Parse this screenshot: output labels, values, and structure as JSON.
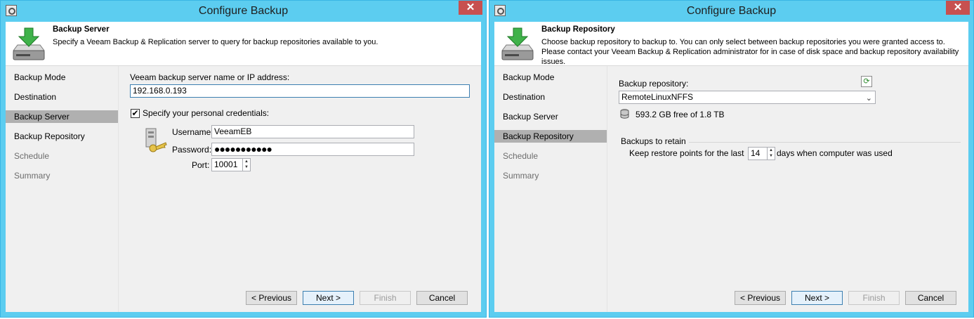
{
  "colors": {
    "titlebar": "#5ccdf0",
    "close": "#c75050",
    "accent": "#3c7fb1",
    "selected": "#b0b0b0"
  },
  "left": {
    "title": "Configure Backup",
    "close_label": "✕",
    "header": {
      "title": "Backup Server",
      "description": "Specify a Veeam Backup & Replication server to query for backup repositories available to you.",
      "icon": "download-drive-icon"
    },
    "nav": [
      {
        "label": "Backup Mode",
        "state": "normal"
      },
      {
        "label": "Destination",
        "state": "normal"
      },
      {
        "label": "Backup Server",
        "state": "active"
      },
      {
        "label": "Backup Repository",
        "state": "normal"
      },
      {
        "label": "Schedule",
        "state": "disabled"
      },
      {
        "label": "Summary",
        "state": "disabled"
      }
    ],
    "form": {
      "server_label": "Veeam backup server name or IP address:",
      "server_value": "192.168.0.193",
      "credentials_label": "Specify your personal credentials:",
      "credentials_checked": true,
      "username_label": "Username:",
      "username_value": "VeeamEB",
      "password_label": "Password:",
      "password_value": "●●●●●●●●●●●",
      "port_label": "Port:",
      "port_value": "10001"
    },
    "buttons": {
      "previous": "< Previous",
      "next": "Next >",
      "finish": "Finish",
      "cancel": "Cancel"
    }
  },
  "right": {
    "title": "Configure Backup",
    "close_label": "✕",
    "header": {
      "title": "Backup Repository",
      "description": "Choose backup repository to backup to. You can only select between backup repositories you were granted access to. Please contact your Veeam Backup & Replication administrator for in case of disk space and backup repository availability issues.",
      "icon": "download-drive-icon"
    },
    "nav": [
      {
        "label": "Backup Mode",
        "state": "normal"
      },
      {
        "label": "Destination",
        "state": "normal"
      },
      {
        "label": "Backup Server",
        "state": "normal"
      },
      {
        "label": "Backup Repository",
        "state": "active"
      },
      {
        "label": "Schedule",
        "state": "disabled"
      },
      {
        "label": "Summary",
        "state": "disabled"
      }
    ],
    "form": {
      "repo_label": "Backup repository:",
      "repo_value": "RemoteLinuxNFFS",
      "free_space": "593.2 GB free of 1.8 TB",
      "retain_group": "Backups to retain",
      "keep_prefix": "Keep restore points for the last",
      "keep_value": "14",
      "keep_suffix": "days when computer was used"
    },
    "buttons": {
      "previous": "< Previous",
      "next": "Next >",
      "finish": "Finish",
      "cancel": "Cancel"
    }
  }
}
